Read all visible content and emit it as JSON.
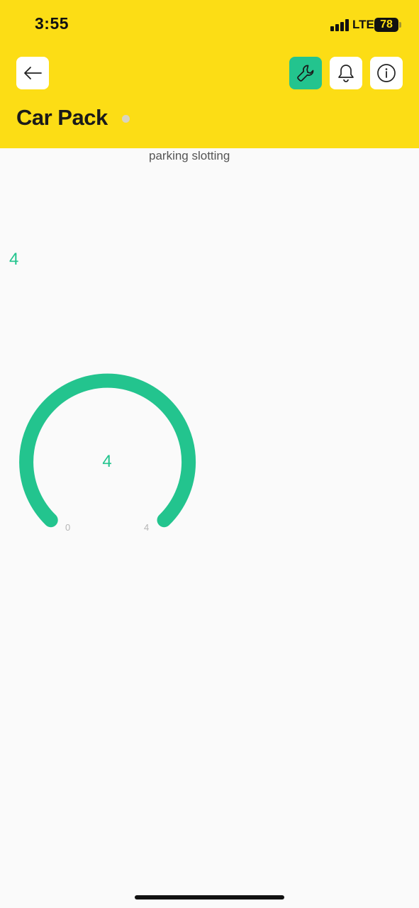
{
  "status_bar": {
    "time": "3:55",
    "network": "LTE",
    "battery": "78"
  },
  "header": {
    "title": "Car Pack",
    "buttons": {
      "back": "back-arrow-icon",
      "tool": "wrench-icon",
      "notifications": "bell-icon",
      "info": "info-icon"
    },
    "colors": {
      "background": "#fcdd15",
      "tool_button": "#23c48e"
    }
  },
  "widgets": {
    "label_widget": {
      "label": "parking slotting"
    },
    "value_display": {
      "value": "4"
    },
    "gauge": {
      "value": "4",
      "min": "0",
      "max": "4",
      "level": 1.0,
      "color": "#23c48e"
    }
  }
}
